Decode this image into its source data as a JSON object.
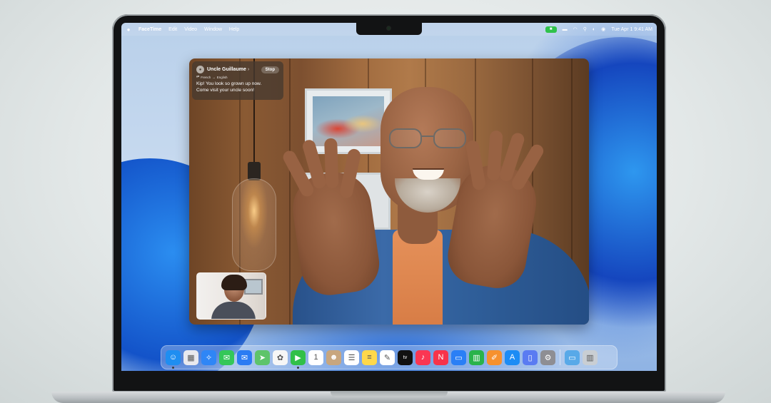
{
  "menubar": {
    "app_name": "FaceTime",
    "menus": [
      "Edit",
      "Video",
      "Window",
      "Help"
    ],
    "datetime": "Tue Apr 1  9:41 AM"
  },
  "call": {
    "caller_name": "Uncle Guillaume",
    "stop_label": "Stop",
    "language_from": "French",
    "language_arrow": "→",
    "language_to": "English",
    "caption_line_1": "Kip! You look so grown up now.",
    "caption_line_2": "Come visit your uncle soon!"
  },
  "dock": {
    "apps": [
      {
        "name": "Finder",
        "icon": "finder-icon",
        "color": "#1f8ef1"
      },
      {
        "name": "Launchpad",
        "icon": "launchpad-icon",
        "color": "#e9e9ee"
      },
      {
        "name": "Safari",
        "icon": "safari-icon",
        "color": "#2f86f6"
      },
      {
        "name": "Messages",
        "icon": "messages-icon",
        "color": "#34c759"
      },
      {
        "name": "Mail",
        "icon": "mail-icon",
        "color": "#2b7cf3"
      },
      {
        "name": "Maps",
        "icon": "maps-icon",
        "color": "#5ec46a"
      },
      {
        "name": "Photos",
        "icon": "photos-icon",
        "color": "#f6f6f6"
      },
      {
        "name": "FaceTime",
        "icon": "facetime-icon",
        "color": "#31c048"
      },
      {
        "name": "Calendar",
        "icon": "calendar-icon",
        "color": "#ffffff"
      },
      {
        "name": "Contacts",
        "icon": "contacts-icon",
        "color": "#c8a67e"
      },
      {
        "name": "Reminders",
        "icon": "reminders-icon",
        "color": "#ffffff"
      },
      {
        "name": "Notes",
        "icon": "notes-icon",
        "color": "#ffd84a"
      },
      {
        "name": "Freeform",
        "icon": "freeform-icon",
        "color": "#ffffff"
      },
      {
        "name": "TV",
        "icon": "tv-icon",
        "color": "#111111"
      },
      {
        "name": "Music",
        "icon": "music-icon",
        "color": "#fa3653"
      },
      {
        "name": "News",
        "icon": "news-icon",
        "color": "#f7334a"
      },
      {
        "name": "Keynote",
        "icon": "keynote-icon",
        "color": "#2a7ff6"
      },
      {
        "name": "Numbers",
        "icon": "numbers-icon",
        "color": "#29b34a"
      },
      {
        "name": "Pages",
        "icon": "pages-icon",
        "color": "#f6912e"
      },
      {
        "name": "App Store",
        "icon": "app-store-icon",
        "color": "#1c8cf5"
      },
      {
        "name": "iPhone Mirroring",
        "icon": "iphone-mirroring-icon",
        "color": "#5a7bf2"
      },
      {
        "name": "System Settings",
        "icon": "settings-icon",
        "color": "#8e8e93"
      }
    ],
    "trailing": [
      {
        "name": "Downloads",
        "icon": "folder-icon",
        "color": "#58a9e8"
      },
      {
        "name": "Trash",
        "icon": "trash-icon",
        "color": "#c9ced3"
      }
    ]
  }
}
